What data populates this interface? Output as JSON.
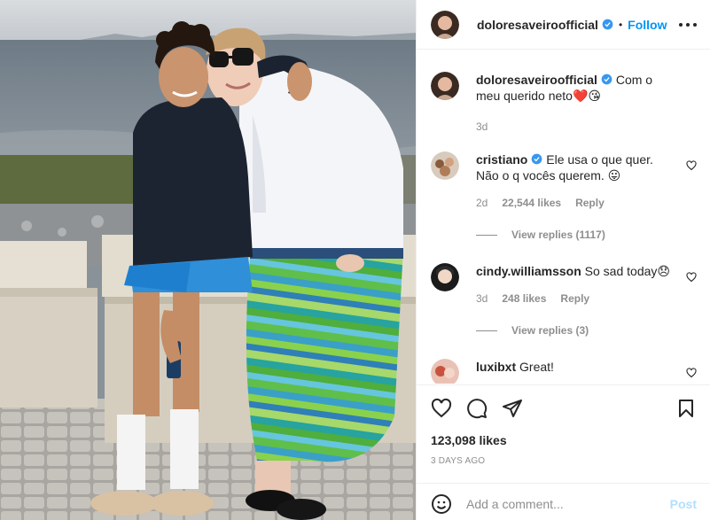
{
  "photo": {
    "description_icon": "photo-grandmother-grandson-seaside"
  },
  "header": {
    "username": "doloresaveiroofficial",
    "dot": "•",
    "follow_label": "Follow",
    "more_icon": "more-horizontal-icon"
  },
  "caption": {
    "username": "doloresaveiroofficial",
    "text": "Com o meu querido neto",
    "emojis": "❤️😘",
    "time": "3d"
  },
  "comments": [
    {
      "username": "cristiano",
      "verified": true,
      "text": "Ele usa o que quer. Não o q vocês querem. 😛",
      "time": "2d",
      "likes": "22,544 likes",
      "reply": "Reply",
      "view_replies": "View replies (1117)"
    },
    {
      "username": "cindy.williamsson",
      "verified": false,
      "text": "So sad today😞",
      "time": "3d",
      "likes": "248 likes",
      "reply": "Reply",
      "view_replies": "View replies (3)"
    },
    {
      "username": "luxibxt",
      "verified": false,
      "text": "Great!"
    }
  ],
  "actions": {
    "like_icon": "heart-icon",
    "comment_icon": "comment-icon",
    "share_icon": "paper-plane-icon",
    "save_icon": "bookmark-icon"
  },
  "post_likes": "123,098 likes",
  "time_ago": "3 DAYS AGO",
  "add_comment": {
    "placeholder": "Add a comment...",
    "post_label": "Post"
  },
  "colors": {
    "accent": "#0095f6",
    "verified": "#3897f0",
    "muted": "#8e8e8e",
    "post_disabled": "#b2dffc"
  }
}
